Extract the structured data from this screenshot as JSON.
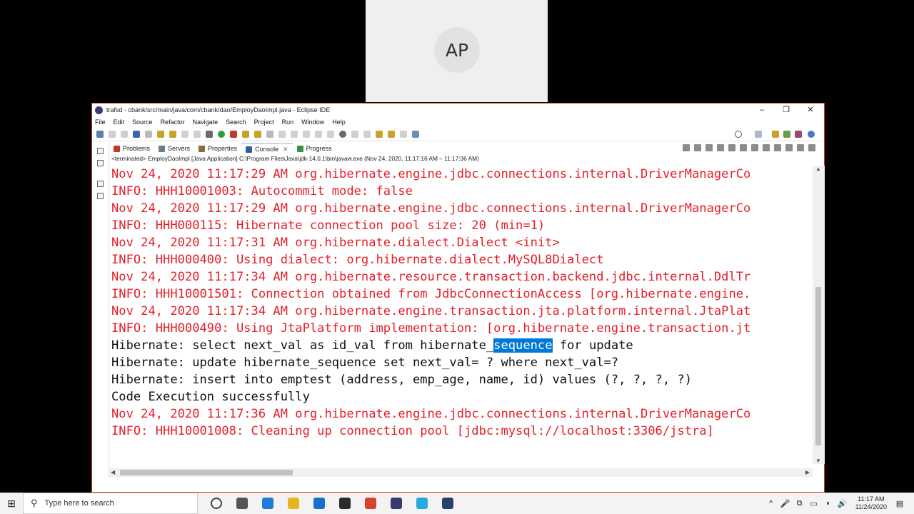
{
  "participant": {
    "initials": "AP"
  },
  "window": {
    "title": "trafsd - cbank/src/main/java/com/cbank/dao/EmployDaoImpl.java - Eclipse IDE",
    "controls": {
      "minimize": "–",
      "restore": "❐",
      "close": "✕"
    }
  },
  "menu": [
    "File",
    "Edit",
    "Source",
    "Refactor",
    "Navigate",
    "Search",
    "Project",
    "Run",
    "Window",
    "Help"
  ],
  "view_tabs": [
    {
      "label": "Problems",
      "icon": "problems-icon",
      "color": "#c0392b"
    },
    {
      "label": "Servers",
      "icon": "servers-icon",
      "color": "#6b7b8c"
    },
    {
      "label": "Properties",
      "icon": "properties-icon",
      "color": "#8a6d3b"
    },
    {
      "label": "Console",
      "icon": "console-icon",
      "color": "#2d5f9a"
    },
    {
      "label": "Progress",
      "icon": "progress-icon",
      "color": "#3e8e41"
    }
  ],
  "console_close": "✕",
  "status_line": "<terminated> EmployDaoImpl [Java Application] C:\\Program Files\\Java\\jdk-14.0.1\\bin\\javaw.exe (Nov 24, 2020, 11:17:16 AM – 11:17:36 AM)",
  "console_lines": [
    {
      "text": "Nov 24, 2020 11:17:29 AM org.hibernate.engine.jdbc.connections.internal.DriverManagerCo",
      "kind": "red"
    },
    {
      "text": "INFO: HHH10001003: Autocommit mode: false",
      "kind": "red"
    },
    {
      "text": "Nov 24, 2020 11:17:29 AM org.hibernate.engine.jdbc.connections.internal.DriverManagerCo",
      "kind": "red"
    },
    {
      "text": "INFO: HHH000115: Hibernate connection pool size: 20 (min=1)",
      "kind": "red"
    },
    {
      "text": "Nov 24, 2020 11:17:31 AM org.hibernate.dialect.Dialect <init>",
      "kind": "red"
    },
    {
      "text": "INFO: HHH000400: Using dialect: org.hibernate.dialect.MySQL8Dialect",
      "kind": "red"
    },
    {
      "text": "Nov 24, 2020 11:17:34 AM org.hibernate.resource.transaction.backend.jdbc.internal.DdlTr",
      "kind": "red"
    },
    {
      "text": "INFO: HHH10001501: Connection obtained from JdbcConnectionAccess [org.hibernate.engine.",
      "kind": "red"
    },
    {
      "text": "Nov 24, 2020 11:17:34 AM org.hibernate.engine.transaction.jta.platform.internal.JtaPlat",
      "kind": "red"
    },
    {
      "text": "INFO: HHH000490: Using JtaPlatform implementation: [org.hibernate.engine.transaction.jt",
      "kind": "red"
    },
    {
      "text": "Hibernate: select next_val as id_val from hibernate_",
      "selected": "sequence",
      "after": " for update",
      "kind": "black"
    },
    {
      "text": "Hibernate: update hibernate_sequence set next_val= ? where next_val=?",
      "kind": "black"
    },
    {
      "text": "Hibernate: insert into emptest (address, emp_age, name, id) values (?, ?, ?, ?)",
      "kind": "black"
    },
    {
      "text": "Code Execution successfully",
      "kind": "black"
    },
    {
      "text": "Nov 24, 2020 11:17:36 AM org.hibernate.engine.jdbc.connections.internal.DriverManagerCo",
      "kind": "red"
    },
    {
      "text": "INFO: HHH10001008: Cleaning up connection pool [jdbc:mysql://localhost:3306/jstra]",
      "kind": "red"
    }
  ],
  "scroll": {
    "left_arrow": "◀",
    "right_arrow": "▶",
    "up_arrow": "▲",
    "down_arrow": "▼"
  },
  "taskbar": {
    "start_icon": "⊞",
    "search_icon": "⚲",
    "search_placeholder": "Type here to search",
    "apps": [
      {
        "name": "cortana-icon",
        "color": "#444"
      },
      {
        "name": "task-view-icon",
        "color": "#555"
      },
      {
        "name": "edge-icon",
        "color": "#1e7bd8"
      },
      {
        "name": "file-explorer-icon",
        "color": "#e7b521"
      },
      {
        "name": "mail-icon",
        "color": "#1b6fc9"
      },
      {
        "name": "terminal-icon",
        "color": "#2b2b2b"
      },
      {
        "name": "chrome-icon",
        "color": "#d8422f"
      },
      {
        "name": "eclipse-icon",
        "color": "#3b3a6e"
      },
      {
        "name": "browser-icon",
        "color": "#2aa9df"
      },
      {
        "name": "vscode-icon",
        "color": "#2c3e6b"
      }
    ],
    "tray_icons": [
      "^",
      "🎤",
      "⧉",
      "▭",
      "◗",
      "🔊"
    ],
    "time": "11:17 AM",
    "date": "11/24/2020",
    "notification_icon": "▤"
  }
}
